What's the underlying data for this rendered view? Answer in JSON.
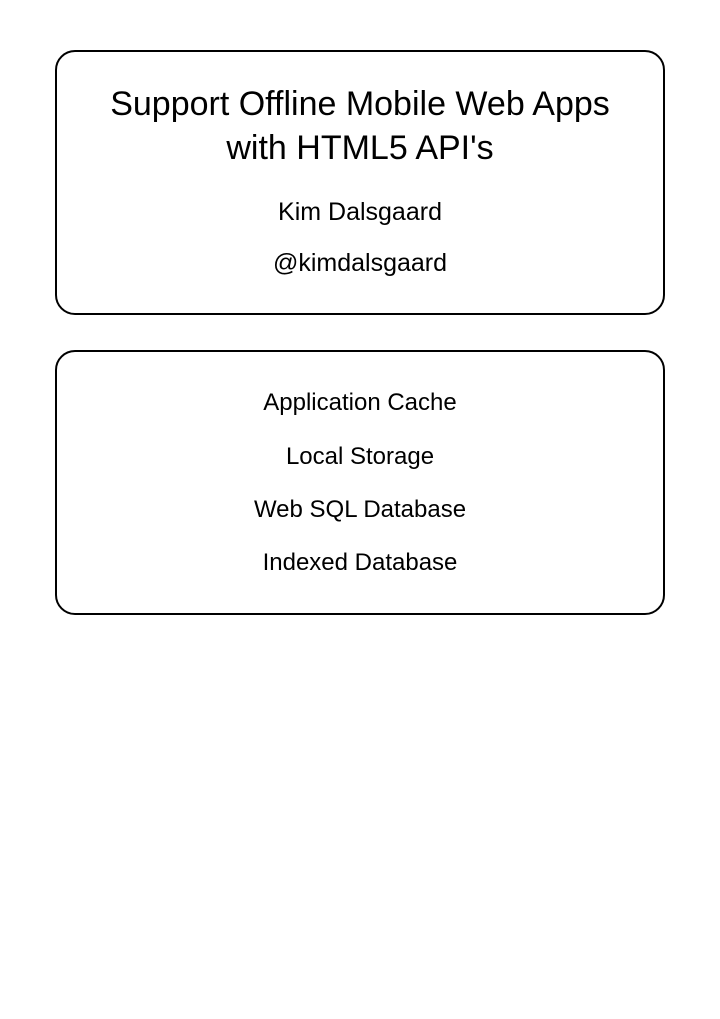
{
  "slide1": {
    "title": "Support Offline Mobile Web Apps with HTML5 API's",
    "author": "Kim Dalsgaard",
    "handle": "@kimdalsgaard"
  },
  "slide2": {
    "items": [
      "Application Cache",
      "Local Storage",
      "Web SQL Database",
      "Indexed Database"
    ]
  }
}
